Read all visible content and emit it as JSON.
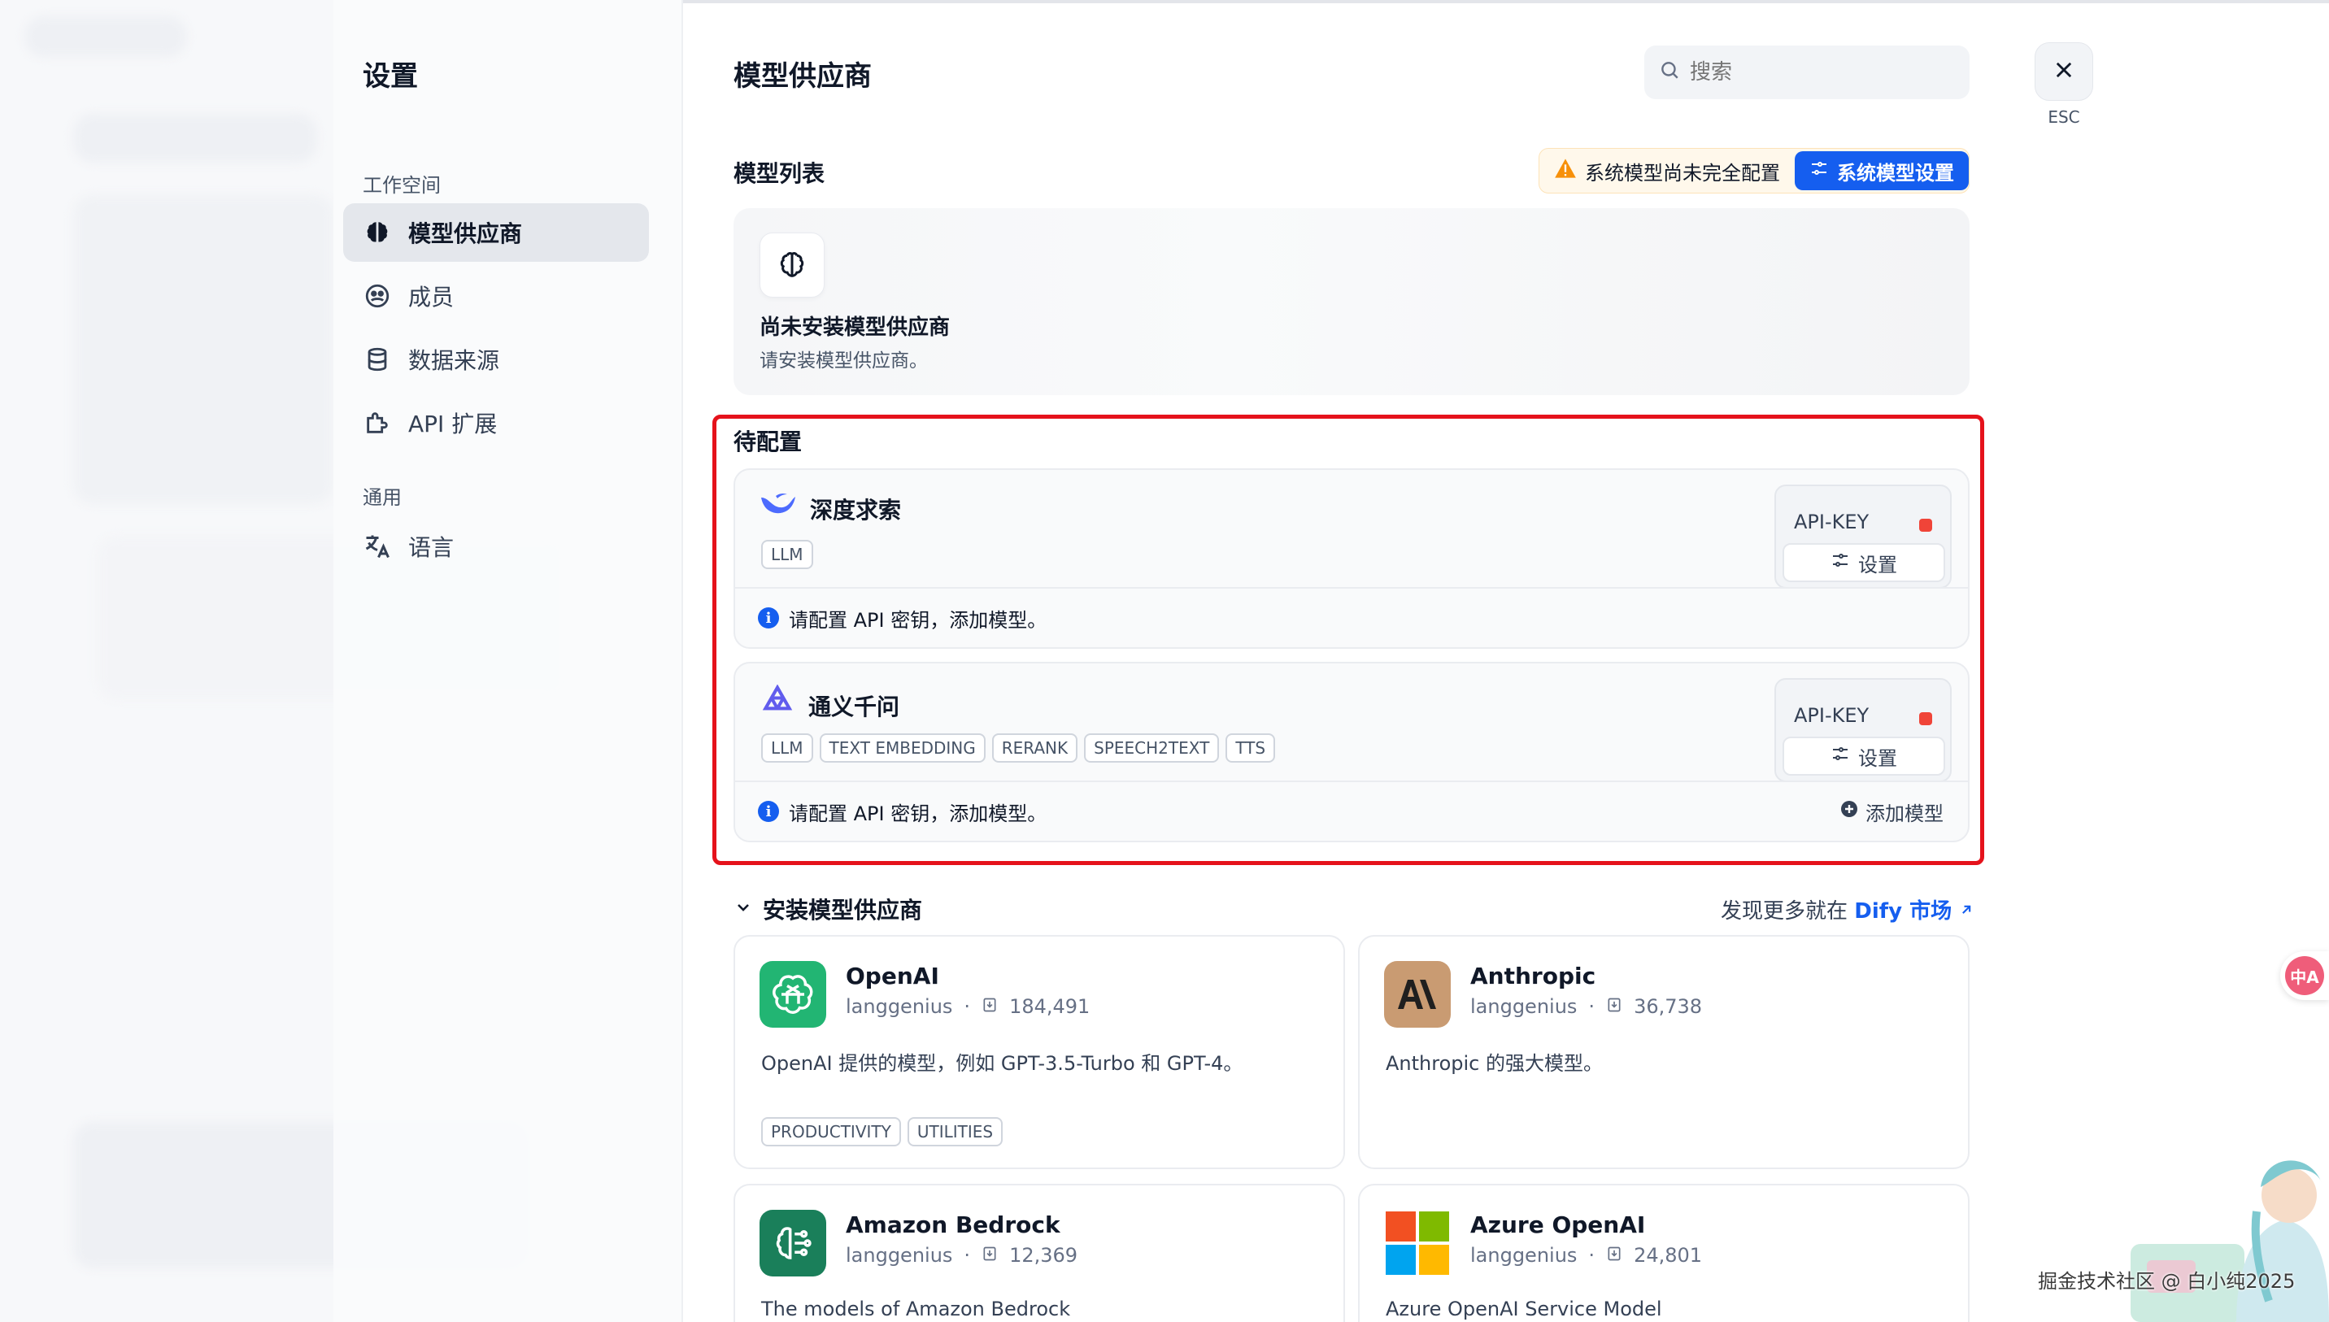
{
  "nav": {
    "title": "设置",
    "group_workspace": "工作空间",
    "items_workspace": [
      {
        "label": "模型供应商",
        "icon": "brain-icon",
        "active": true
      },
      {
        "label": "成员",
        "icon": "members-icon"
      },
      {
        "label": "数据来源",
        "icon": "database-icon"
      },
      {
        "label": "API 扩展",
        "icon": "puzzle-icon"
      }
    ],
    "group_general": "通用",
    "items_general": [
      {
        "label": "语言",
        "icon": "translate-icon"
      }
    ]
  },
  "header": {
    "title": "模型供应商",
    "search_placeholder": "搜索",
    "close_label": "ESC"
  },
  "model_list": {
    "title": "模型列表",
    "warning": "系统模型尚未完全配置",
    "system_settings_button": "系统模型设置",
    "empty_title": "尚未安装模型供应商",
    "empty_desc": "请安装模型供应商。"
  },
  "pending": {
    "title": "待配置",
    "providers": [
      {
        "name": "深度求索",
        "tags": [
          "LLM"
        ],
        "api_label": "API-KEY",
        "settings_button": "设置",
        "notice": "请配置 API 密钥，添加模型。"
      },
      {
        "name": "通义千问",
        "tags": [
          "LLM",
          "TEXT EMBEDDING",
          "RERANK",
          "SPEECH2TEXT",
          "TTS"
        ],
        "api_label": "API-KEY",
        "settings_button": "设置",
        "notice": "请配置 API 密钥，添加模型。",
        "add_model": "添加模型"
      }
    ]
  },
  "install": {
    "title": "安装模型供应商",
    "market_prefix": "发现更多就在",
    "market_link": "Dify 市场",
    "plugins": [
      {
        "name": "OpenAI",
        "author": "langgenius",
        "downloads": "184,491",
        "desc": "OpenAI 提供的模型，例如 GPT-3.5-Turbo 和 GPT-4。",
        "tags": [
          "PRODUCTIVITY",
          "UTILITIES"
        ],
        "logo_color": "#22b573"
      },
      {
        "name": "Anthropic",
        "author": "langgenius",
        "downloads": "36,738",
        "desc": "Anthropic 的强大模型。",
        "tags": [],
        "logo_color": "#c99b72"
      },
      {
        "name": "Amazon Bedrock",
        "author": "langgenius",
        "downloads": "12,369",
        "desc": "The models of Amazon Bedrock",
        "tags": [],
        "logo_color": "#1a7f5a"
      },
      {
        "name": "Azure OpenAI",
        "author": "langgenius",
        "downloads": "24,801",
        "desc": "Azure OpenAI Service Model",
        "tags": [],
        "logo_color": "#f25022"
      }
    ]
  },
  "overlay": {
    "translate_fab": "中A",
    "watermark": "掘金技术社区 @ 白小纯2025"
  },
  "colors": {
    "accent": "#155eef",
    "warning": "#f79009",
    "error": "#f04438",
    "highlight_border": "#e5121b"
  }
}
